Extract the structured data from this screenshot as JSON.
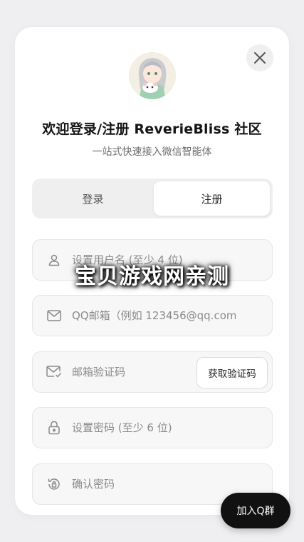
{
  "dialog": {
    "title": "欢迎登录/注册 ReverieBliss 社区",
    "subtitle": "一站式快速接入微信智能体",
    "close_icon": "close-icon",
    "avatar": "anime-character-avatar"
  },
  "tabs": [
    {
      "label": "登录",
      "active": false
    },
    {
      "label": "注册",
      "active": true
    }
  ],
  "form": {
    "username": {
      "placeholder": "设置用户名 (至少 4 位)",
      "value": "",
      "icon": "user-icon"
    },
    "email": {
      "placeholder": "QQ邮箱（例如 123456@qq.com）",
      "value": "",
      "icon": "mail-icon"
    },
    "email_code": {
      "placeholder": "邮箱验证码",
      "value": "",
      "icon": "mail-check-icon",
      "button_label": "获取验证码"
    },
    "password": {
      "placeholder": "设置密码 (至少 6 位)",
      "value": "",
      "icon": "lock-icon"
    },
    "confirm_password": {
      "placeholder": "确认密码",
      "value": "",
      "icon": "history-icon"
    }
  },
  "watermark": "宝贝游戏网亲测",
  "join_group_label": "加入Q群",
  "colors": {
    "accent": "#111111",
    "field_bg": "#f7f7f7",
    "page_bg": "#efeff1"
  }
}
